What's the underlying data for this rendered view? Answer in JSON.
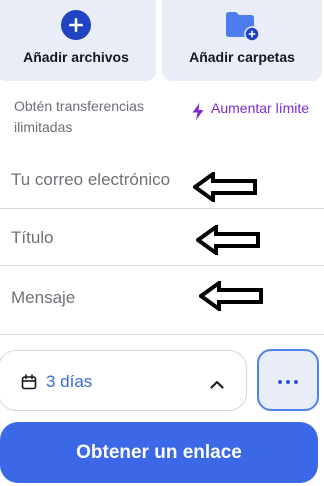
{
  "add": {
    "files_label": "Añadir archivos",
    "folders_label": "Añadir carpetas"
  },
  "upsell": {
    "text": "Obtén transferencias ilimitadas",
    "button_label": "Aumentar límite"
  },
  "form": {
    "email_placeholder": "Tu correo electrónico",
    "title_placeholder": "Título",
    "message_placeholder": "Mensaje"
  },
  "expiry": {
    "value": "3 días"
  },
  "cta": {
    "label": "Obtener un enlace"
  },
  "colors": {
    "accent": "#3b68e6",
    "upsell": "#7f2bd4",
    "card_bg": "#e8edf8"
  },
  "icons": {
    "add_files": "plus-circle-icon",
    "add_folders": "folder-plus-icon",
    "upsell": "lightning-bolt-icon",
    "expiry": "calendar-icon",
    "toggle": "chevron-up-icon",
    "more": "more-dots-icon",
    "annotation": "left-arrow-icon"
  }
}
